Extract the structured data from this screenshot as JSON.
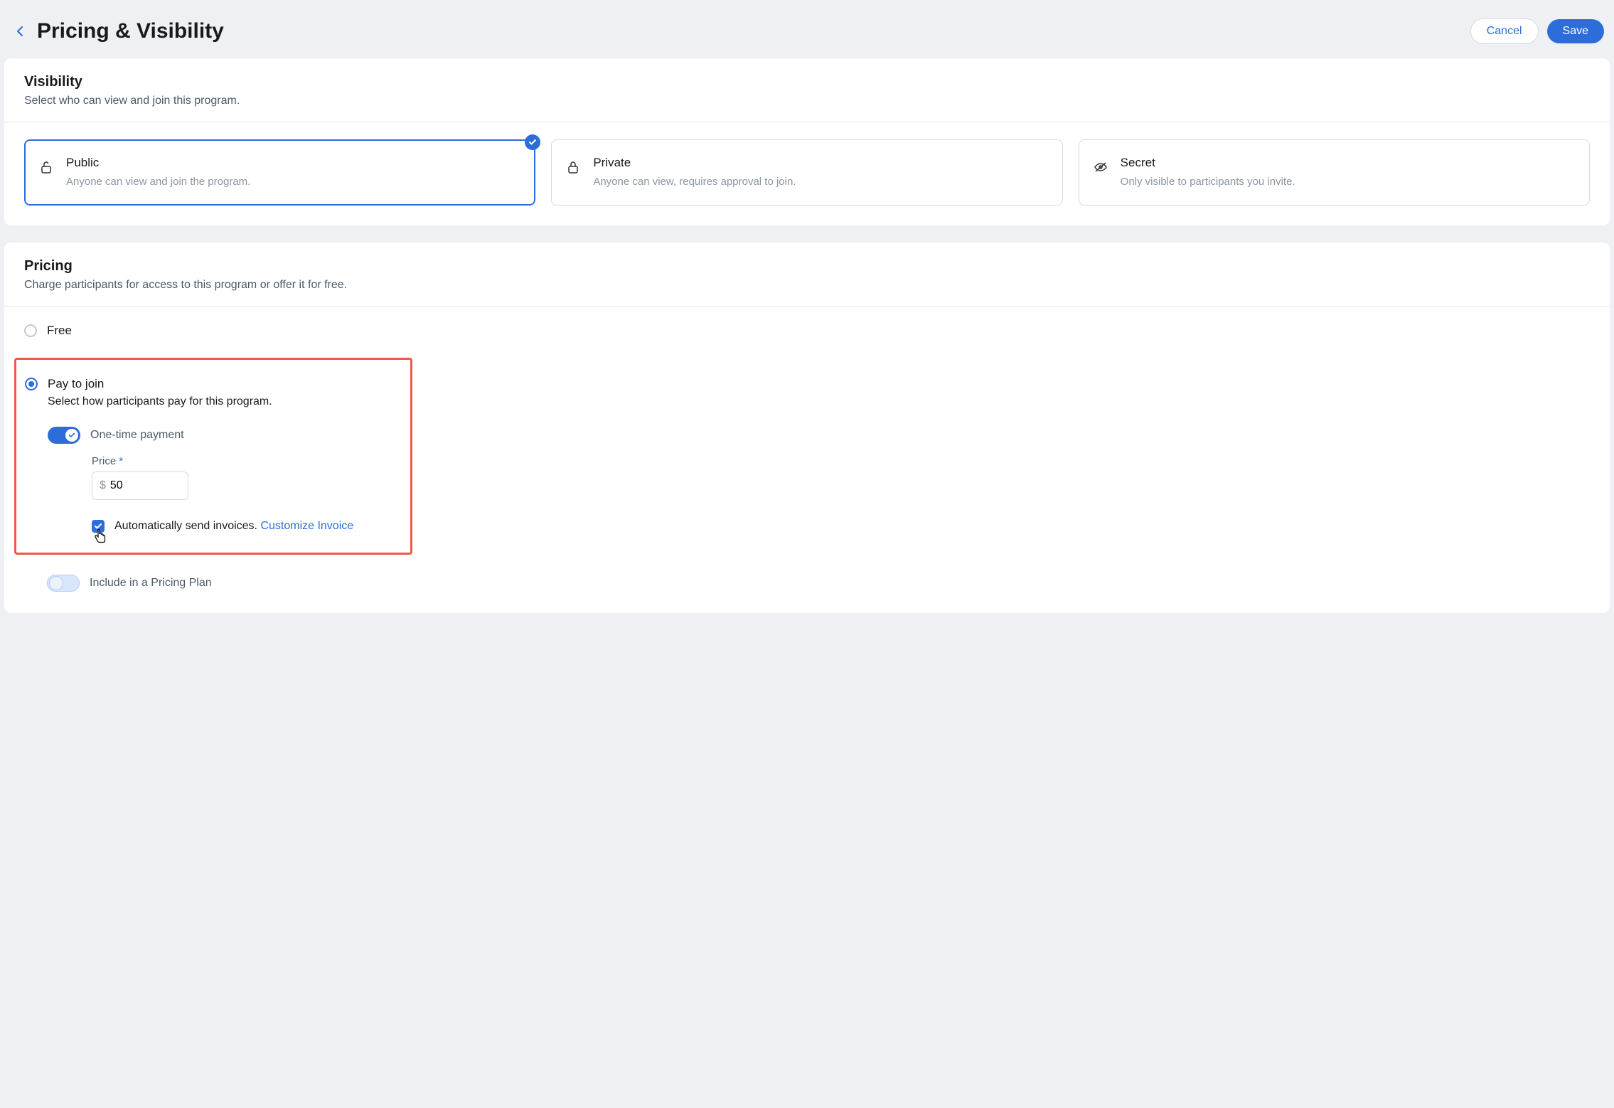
{
  "header": {
    "title": "Pricing & Visibility",
    "cancel_label": "Cancel",
    "save_label": "Save"
  },
  "visibility": {
    "title": "Visibility",
    "subtitle": "Select who can view and join this program.",
    "options": [
      {
        "title": "Public",
        "desc": "Anyone can view and join the program.",
        "selected": true
      },
      {
        "title": "Private",
        "desc": "Anyone can view, requires approval to join.",
        "selected": false
      },
      {
        "title": "Secret",
        "desc": "Only visible to participants you invite.",
        "selected": false
      }
    ]
  },
  "pricing": {
    "title": "Pricing",
    "subtitle": "Charge participants for access to this program or offer it for free.",
    "free_label": "Free",
    "pay": {
      "label": "Pay to join",
      "subtitle": "Select how participants pay for this program.",
      "one_time_label": "One-time payment",
      "price_label": "Price",
      "currency": "$",
      "price_value": "50",
      "invoice_text": "Automatically send invoices.",
      "customize_link": "Customize Invoice"
    },
    "include_label": "Include in a Pricing Plan"
  }
}
